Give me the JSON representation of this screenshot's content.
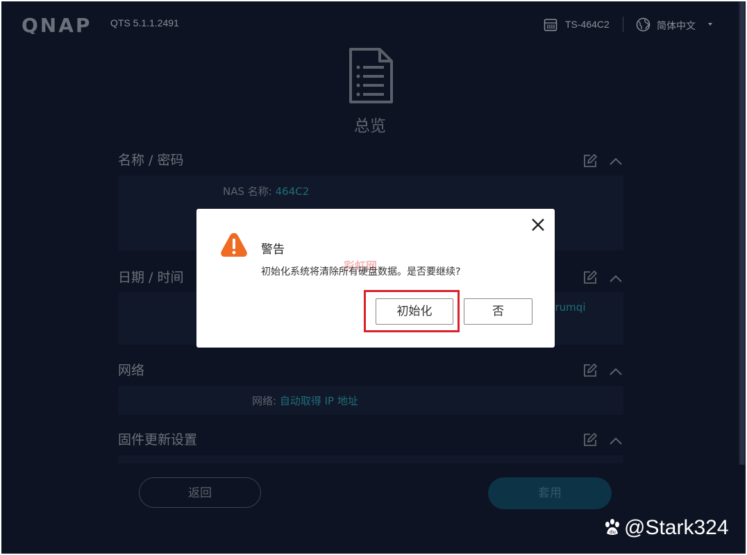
{
  "header": {
    "logo": "QNAP",
    "version": "QTS 5.1.1.2491",
    "device": "TS-464C2",
    "language": "简体中文"
  },
  "page": {
    "title": "总览"
  },
  "sections": [
    {
      "title": "名称 / 密码",
      "fields": [
        {
          "label": "NAS 名称:",
          "value": "464C2"
        }
      ]
    },
    {
      "title": "日期 / 时间",
      "partial_value": "urumqi"
    },
    {
      "title": "网络",
      "fields": [
        {
          "label": "网络:",
          "value": "自动取得 IP 地址"
        }
      ]
    },
    {
      "title": "固件更新设置"
    }
  ],
  "footer": {
    "back_label": "返回",
    "apply_label": "套用"
  },
  "dialog": {
    "title": "警告",
    "message": "初始化系统将清除所有硬盘数据。是否要继续?",
    "confirm_label": "初始化",
    "cancel_label": "否",
    "overlay_watermark": "彩虹网"
  },
  "watermark": {
    "text": "@Stark324"
  },
  "colors": {
    "background": "#0d1322",
    "accent_teal": "#1f6d7a",
    "warning": "#ef6a22",
    "highlight_box": "#d8222a"
  },
  "icons": {
    "device": "nas-device-icon",
    "language": "globe-icon",
    "overview": "document-icon",
    "edit": "edit-icon",
    "collapse": "chevron-up-icon",
    "close": "close-icon",
    "warning": "warning-icon"
  }
}
